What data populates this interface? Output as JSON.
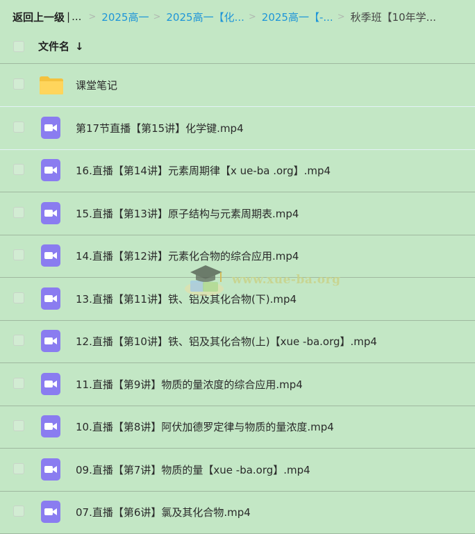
{
  "breadcrumb": {
    "back_label": "返回上一级",
    "separator": "|",
    "ellipsis": "...",
    "items": [
      {
        "label": "2025高一"
      },
      {
        "label": "2025高一【化..."
      },
      {
        "label": "2025高一【-..."
      }
    ],
    "current": "秋季班【10年学..."
  },
  "header": {
    "name_column": "文件名",
    "sort_icon": "arrow-down-icon"
  },
  "files": [
    {
      "name": "课堂笔记",
      "type": "folder"
    },
    {
      "name": "第17节直播【第15讲】化学键.mp4",
      "type": "video"
    },
    {
      "name": "16.直播【第14讲】元素周期律【x ue-ba .org】.mp4",
      "type": "video"
    },
    {
      "name": "15.直播【第13讲】原子结构与元素周期表.mp4",
      "type": "video"
    },
    {
      "name": "14.直播【第12讲】元素化合物的综合应用.mp4",
      "type": "video"
    },
    {
      "name": "13.直播【第11讲】铁、铝及其化合物(下).mp4",
      "type": "video"
    },
    {
      "name": "12.直播【第10讲】铁、铝及其化合物(上)【xue -ba.org】.mp4",
      "type": "video"
    },
    {
      "name": "11.直播【第9讲】物质的量浓度的综合应用.mp4",
      "type": "video"
    },
    {
      "name": "10.直播【第8讲】阿伏加德罗定律与物质的量浓度.mp4",
      "type": "video"
    },
    {
      "name": "09.直播【第7讲】物质的量【xue -ba.org】.mp4",
      "type": "video"
    },
    {
      "name": "07.直播【第6讲】氯及其化合物.mp4",
      "type": "video"
    }
  ],
  "watermark": {
    "text": "www.xue-ba.org",
    "icon": "graduation-cap-icon"
  },
  "colors": {
    "background": "#c3e7c5",
    "link": "#1e95d8",
    "video_icon": "#8a7cf0",
    "folder_icon": "#ffd55c"
  }
}
